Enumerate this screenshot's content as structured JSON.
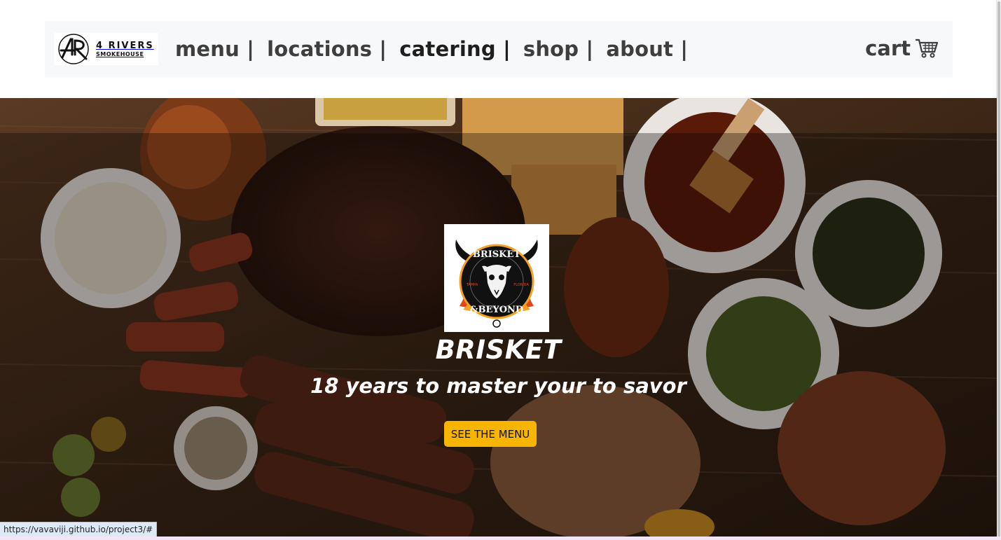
{
  "brand": {
    "logo_mark": "4R",
    "name_line1": "4 RIVERS",
    "name_line2": "SMOKEHOUSE"
  },
  "nav": {
    "items": [
      {
        "label": "menu |"
      },
      {
        "label": "locations |"
      },
      {
        "label": "catering |"
      },
      {
        "label": "shop |"
      },
      {
        "label": "about |"
      }
    ],
    "active_index": 2,
    "cart_label": "cart",
    "cart_icon": "shopping-cart-icon"
  },
  "hero": {
    "badge": {
      "line1": "BRISKET",
      "line2": "&BEYOND",
      "left_small": "TAMPA",
      "right_small": "FLORIDA",
      "icon": "bull-skull-icon"
    },
    "title": "BRISKET",
    "subtitle": "18 years to master your to savor",
    "cta_label": "SEE THE MENU",
    "background": "bbq-food-spread-image"
  },
  "status_bar": {
    "url": "https://vavaviji.github.io/project3/#"
  },
  "colors": {
    "nav_bg": "#f7f8fa",
    "nav_text": "#3e3e3e",
    "cta_bg": "#f7b500",
    "hero_text": "#ffffff"
  }
}
